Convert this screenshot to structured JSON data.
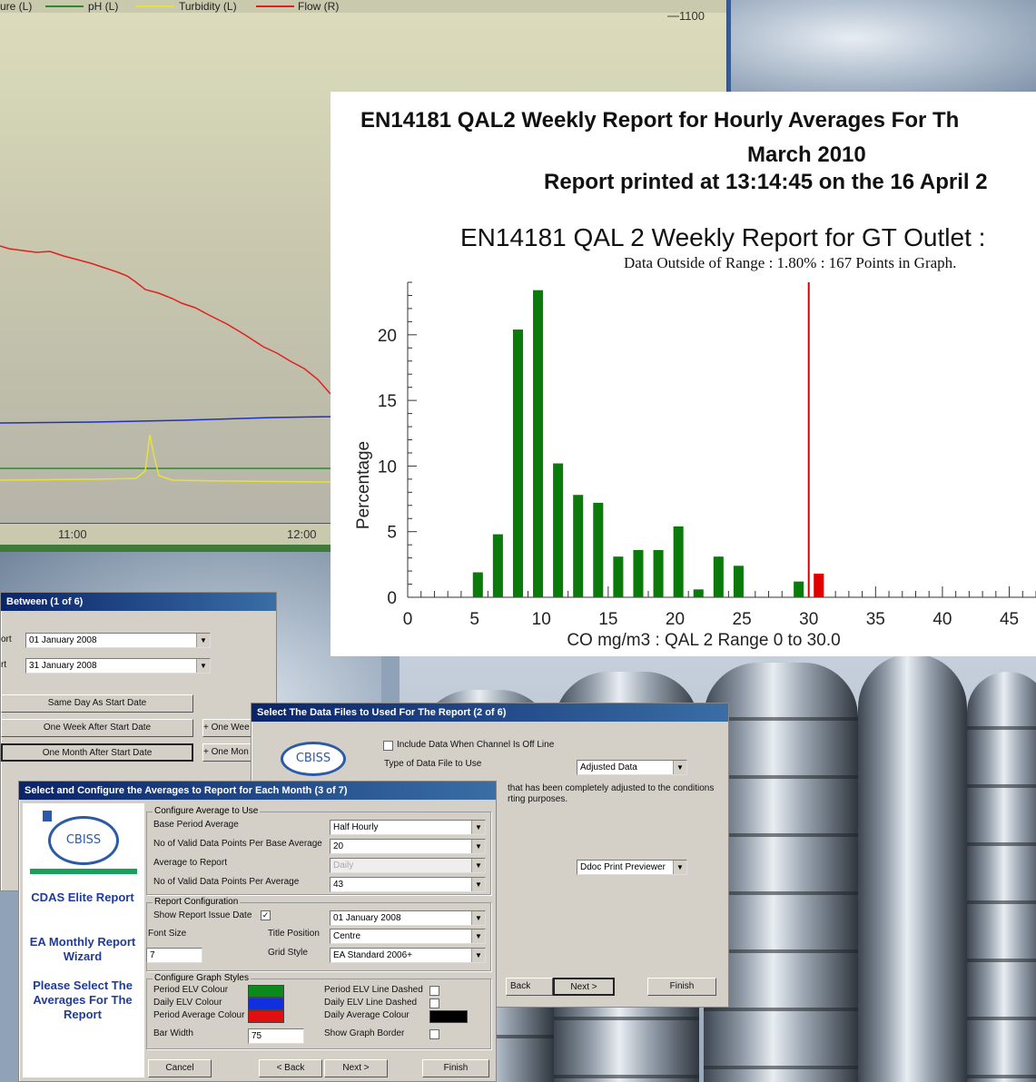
{
  "trend": {
    "legend": [
      "ure (L)",
      "pH (L)",
      "Turbidity (L)",
      "Flow (R)"
    ],
    "legend_colors": [
      "#2b8a2b",
      "#e6e040",
      "#e02020"
    ],
    "y_right_label": "1100",
    "x_labels": [
      "11:00",
      "12:00"
    ]
  },
  "report": {
    "title_line1": "EN14181 QAL2 Weekly Report for Hourly Averages For Th",
    "title_line2": "March 2010",
    "printed": "Report printed at 13:14:45 on the 16 April 2",
    "chart_title": "EN14181 QAL 2 Weekly Report for GT Outlet :",
    "subtitle": "Data Outside of Range : 1.80% : 167 Points in Graph."
  },
  "chart_data": {
    "type": "bar",
    "title": "EN14181 QAL 2 Weekly Report for GT Outlet :",
    "subtitle": "Data Outside of Range : 1.80% : 167 Points in Graph.",
    "xlabel": "CO mg/m3 : QAL 2 Range 0 to 30.0",
    "ylabel": "Percentage",
    "xlim": [
      0,
      47
    ],
    "ylim": [
      0,
      24
    ],
    "x_ticks": [
      0,
      5,
      10,
      15,
      20,
      25,
      30,
      35,
      40,
      45
    ],
    "y_ticks": [
      0,
      5,
      10,
      15,
      20
    ],
    "reference_line_x": 30,
    "series": [
      {
        "color": "#0a7a0a",
        "x": [
          5.25,
          6.75,
          8.25,
          9.75,
          11.25,
          12.75,
          14.25,
          15.75,
          17.25,
          18.75,
          20.25,
          21.75,
          23.25,
          24.75,
          29.25
        ],
        "values": [
          1.9,
          4.8,
          20.4,
          23.4,
          10.2,
          7.8,
          7.2,
          3.1,
          3.6,
          3.6,
          5.4,
          0.6,
          3.1,
          2.4,
          1.2
        ]
      },
      {
        "color": "#e00000",
        "x": [
          30.75
        ],
        "values": [
          1.8
        ]
      }
    ]
  },
  "dialog1": {
    "title": "Between (1 of 6)",
    "label_start": "ort",
    "label_end": "rt",
    "start_date": "01   January   2008",
    "end_date": "31   January   2008",
    "btn_same_day": "Same Day As Start Date",
    "btn_one_week": "One Week After Start Date",
    "btn_one_month": "One Month After Start Date",
    "btn_plus_week": "+ One Wee",
    "btn_plus_month": "+ One Mon"
  },
  "dialog2": {
    "title": "Select The Data Files to Used For The Report (2 of 6)",
    "include_offline": "Include Data When Channel Is Off Line",
    "type_label": "Type of Data File to Use",
    "type_value": "Adjusted Data",
    "note_line1": "that has been completely adjusted to the conditions",
    "note_line2": "rting purposes.",
    "previewer": "Ddoc Print Previewer",
    "btn_back": "Back",
    "btn_next": "Next >",
    "btn_finish": "Finish"
  },
  "dialog3": {
    "title": "Select and Configure the Averages to Report for Each Month (3 of 7)",
    "logo_text": "CBISS",
    "side_links": [
      "CDAS Elite Report",
      "EA Monthly Report Wizard",
      "Please Select The Averages For The Report"
    ],
    "grp_average": "Configure Average to Use",
    "base_period_label": "Base Period Average",
    "base_period_value": "Half Hourly",
    "valid_base_label": "No of Valid Data Points Per Base Average",
    "valid_base_value": "20",
    "avg_report_label": "Average to Report",
    "avg_report_value": "Daily",
    "valid_avg_label": "No of Valid Data Points Per Average",
    "valid_avg_value": "43",
    "grp_report": "Report Configuration",
    "issue_date_label": "Show Report Issue Date",
    "issue_date_value": "01   January   2008",
    "font_size_label": "Font Size",
    "font_size_value": "7",
    "title_pos_label": "Title Position",
    "title_pos_value": "Centre",
    "grid_style_label": "Grid Style",
    "grid_style_value": "EA Standard 2006+",
    "grp_graph": "Configure Graph Styles",
    "period_elv_colour": "Period ELV Colour",
    "daily_elv_colour": "Daily ELV Colour",
    "period_avg_colour": "Period Average Colour",
    "period_elv_dashed": "Period ELV Line Dashed",
    "daily_elv_dashed": "Daily ELV Line Dashed",
    "daily_avg_colour": "Daily Average Colour",
    "bar_width_label": "Bar Width",
    "bar_width_value": "75",
    "show_border": "Show Graph Border",
    "colours": {
      "period_elv": "#0a8a1a",
      "daily_elv": "#1030e0",
      "period_avg": "#e01010",
      "daily_avg": "#000000"
    },
    "btn_cancel": "Cancel",
    "btn_back": "< Back",
    "btn_next": "Next >",
    "btn_finish": "Finish"
  }
}
